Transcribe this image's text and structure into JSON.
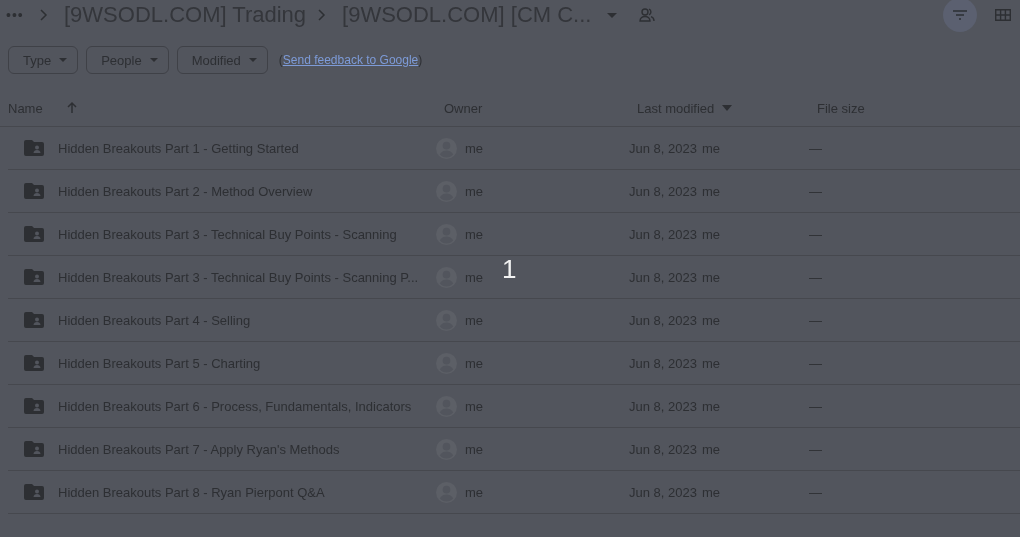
{
  "breadcrumbs": {
    "more": "•••",
    "items": [
      "[9WSODL.COM] Trading",
      "[9WSODL.COM] [CM C..."
    ]
  },
  "filters": [
    {
      "label": "Type"
    },
    {
      "label": "People"
    },
    {
      "label": "Modified"
    }
  ],
  "feedback": {
    "open": "(",
    "link": "Send feedback to Google",
    "close": ")"
  },
  "toolbar": {
    "filter_active": true
  },
  "table": {
    "columns": [
      {
        "label": "Name",
        "kind": "arrow",
        "sorted": true,
        "ascending": true
      },
      {
        "label": "Owner",
        "sorted": false
      },
      {
        "label": "Last modified",
        "kind": "triangle",
        "sorted": true,
        "ascending": false
      },
      {
        "label": "File size",
        "sorted": false
      }
    ],
    "rows": [
      {
        "name": "Hidden Breakouts Part 1 - Getting Started",
        "owner": "me",
        "modified": "Jun 8, 2023",
        "modified_by": "me",
        "size": "—"
      },
      {
        "name": "Hidden Breakouts Part 2 - Method Overview",
        "owner": "me",
        "modified": "Jun 8, 2023",
        "modified_by": "me",
        "size": "—"
      },
      {
        "name": "Hidden Breakouts Part 3 - Technical Buy Points - Scanning",
        "owner": "me",
        "modified": "Jun 8, 2023",
        "modified_by": "me",
        "size": "—"
      },
      {
        "name": "Hidden Breakouts Part 3 - Technical Buy Points - Scanning P...",
        "owner": "me",
        "modified": "Jun 8, 2023",
        "modified_by": "me",
        "size": "—"
      },
      {
        "name": "Hidden Breakouts Part 4 - Selling",
        "owner": "me",
        "modified": "Jun 8, 2023",
        "modified_by": "me",
        "size": "—"
      },
      {
        "name": "Hidden Breakouts Part 5 - Charting",
        "owner": "me",
        "modified": "Jun 8, 2023",
        "modified_by": "me",
        "size": "—"
      },
      {
        "name": "Hidden Breakouts Part 6 - Process, Fundamentals, Indicators",
        "owner": "me",
        "modified": "Jun 8, 2023",
        "modified_by": "me",
        "size": "—"
      },
      {
        "name": "Hidden Breakouts Part 7 - Apply Ryan's Methods",
        "owner": "me",
        "modified": "Jun 8, 2023",
        "modified_by": "me",
        "size": "—"
      },
      {
        "name": "Hidden Breakouts Part 8 - Ryan Pierpont Q&A",
        "owner": "me",
        "modified": "Jun 8, 2023",
        "modified_by": "me",
        "size": "—"
      }
    ]
  },
  "overlay_number": "1"
}
